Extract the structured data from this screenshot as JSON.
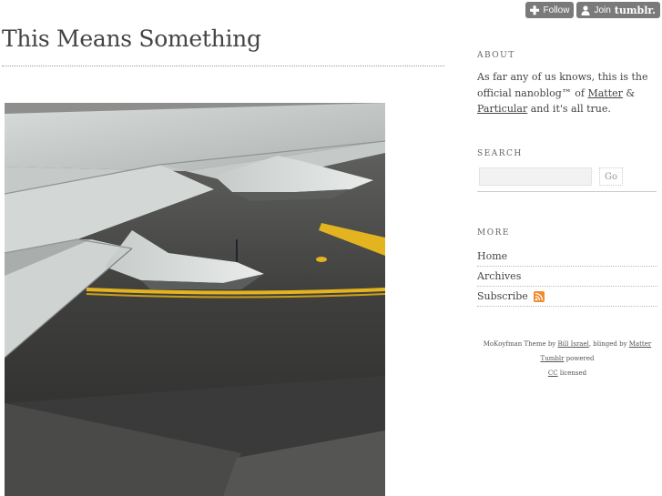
{
  "toolbar": {
    "follow_label": "Follow",
    "join_label": "Join",
    "join_brand": "tumblr."
  },
  "blog": {
    "title": "This Means Something"
  },
  "post": {
    "photo_icon": "airplane-wing-photo"
  },
  "sidebar": {
    "about": {
      "heading": "ABOUT",
      "text_1": "As far any of us knows, this is the official nanoblog™ of",
      "link_matter": "Matter",
      "amp": "&",
      "link_particular": "Particular",
      "text_2": "and it's all true."
    },
    "search": {
      "heading": "SEARCH",
      "placeholder": "",
      "go_label": "Go"
    },
    "more": {
      "heading": "MORE",
      "items": [
        {
          "label": "Home"
        },
        {
          "label": "Archives"
        },
        {
          "label": "Subscribe"
        }
      ]
    },
    "credits": {
      "text_1": "MoKoyfman Theme by",
      "author": "Bill Israel",
      "text_2": ", blinged by",
      "blinger": "Matter",
      "tumblr": "Tumblr",
      "powered": "powered",
      "cc": "CC",
      "licensed": "licensed"
    }
  },
  "colors": {
    "button_bg": "#7a7a7a",
    "rss_orange": "#f28b2e",
    "tarmac_yellow": "#e3b320"
  }
}
